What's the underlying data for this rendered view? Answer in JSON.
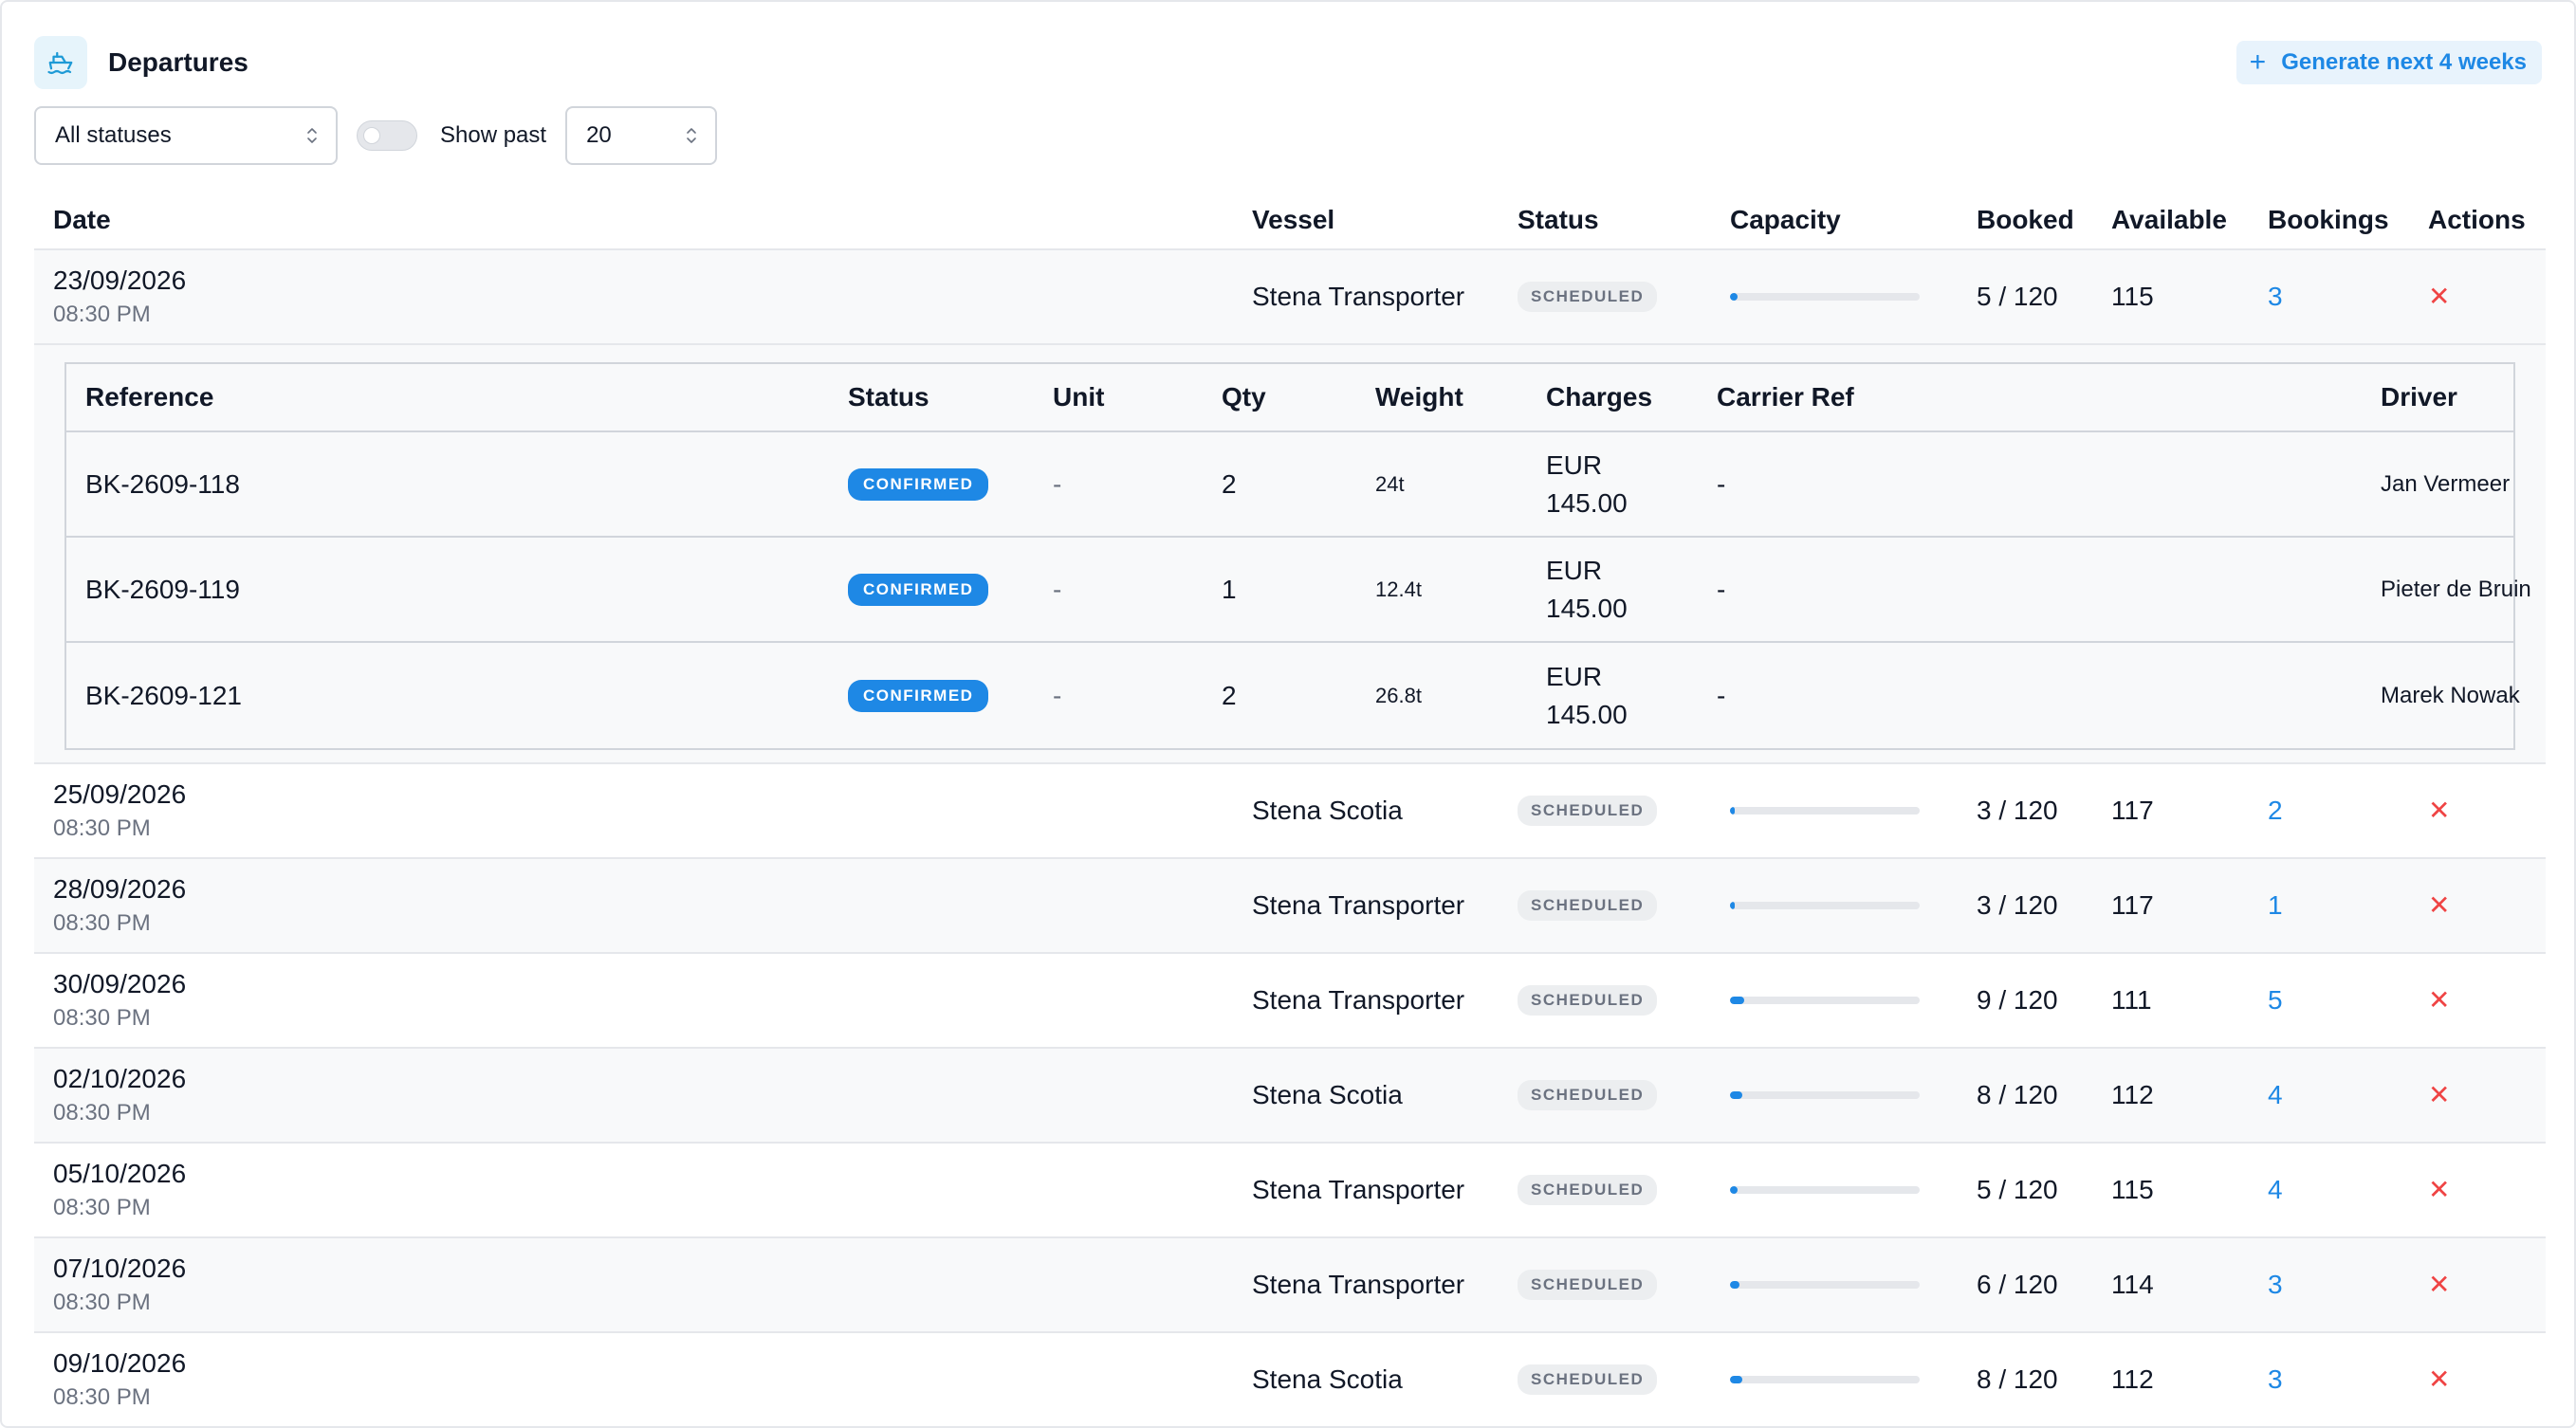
{
  "header": {
    "title": "Departures",
    "generate_label": "Generate next 4 weeks",
    "generate_icon": "plus-icon",
    "logo_icon": "ship-icon"
  },
  "filters": {
    "status_value": "All statuses",
    "show_past_label": "Show past",
    "show_past_on": false,
    "page_size_value": "20"
  },
  "columns": {
    "date": "Date",
    "vessel": "Vessel",
    "status": "Status",
    "capacity": "Capacity",
    "booked": "Booked",
    "available": "Available",
    "bookings": "Bookings",
    "actions": "Actions"
  },
  "departures": [
    {
      "date": "23/09/2026",
      "time": "08:30 PM",
      "vessel": "Stena Transporter",
      "status": "SCHEDULED",
      "capacity": 0.0417,
      "booked": "5 / 120",
      "available": "115",
      "bookings": "3"
    },
    {
      "date": "25/09/2026",
      "time": "08:30 PM",
      "vessel": "Stena Scotia",
      "status": "SCHEDULED",
      "capacity": 0.025,
      "booked": "3 / 120",
      "available": "117",
      "bookings": "2"
    },
    {
      "date": "28/09/2026",
      "time": "08:30 PM",
      "vessel": "Stena Transporter",
      "status": "SCHEDULED",
      "capacity": 0.025,
      "booked": "3 / 120",
      "available": "117",
      "bookings": "1"
    },
    {
      "date": "30/09/2026",
      "time": "08:30 PM",
      "vessel": "Stena Transporter",
      "status": "SCHEDULED",
      "capacity": 0.075,
      "booked": "9 / 120",
      "available": "111",
      "bookings": "5"
    },
    {
      "date": "02/10/2026",
      "time": "08:30 PM",
      "vessel": "Stena Scotia",
      "status": "SCHEDULED",
      "capacity": 0.0667,
      "booked": "8 / 120",
      "available": "112",
      "bookings": "4"
    },
    {
      "date": "05/10/2026",
      "time": "08:30 PM",
      "vessel": "Stena Transporter",
      "status": "SCHEDULED",
      "capacity": 0.0417,
      "booked": "5 / 120",
      "available": "115",
      "bookings": "4"
    },
    {
      "date": "07/10/2026",
      "time": "08:30 PM",
      "vessel": "Stena Transporter",
      "status": "SCHEDULED",
      "capacity": 0.05,
      "booked": "6 / 120",
      "available": "114",
      "bookings": "3"
    },
    {
      "date": "09/10/2026",
      "time": "08:30 PM",
      "vessel": "Stena Scotia",
      "status": "SCHEDULED",
      "capacity": 0.0667,
      "booked": "8 / 120",
      "available": "112",
      "bookings": "3"
    }
  ],
  "booking_columns": {
    "reference": "Reference",
    "status": "Status",
    "unit": "Unit",
    "qty": "Qty",
    "weight": "Weight",
    "charges": "Charges",
    "carrier_ref": "Carrier Ref",
    "driver": "Driver"
  },
  "bookings": [
    {
      "reference": "BK-2609-118",
      "status": "CONFIRMED",
      "unit": "-",
      "qty": "2",
      "weight": "24t",
      "currency": "EUR",
      "amount": "145.00",
      "carrier_ref": "-",
      "driver": "Jan Vermeer"
    },
    {
      "reference": "BK-2609-119",
      "status": "CONFIRMED",
      "unit": "-",
      "qty": "1",
      "weight": "12.4t",
      "currency": "EUR",
      "amount": "145.00",
      "carrier_ref": "-",
      "driver": "Pieter de Bruin"
    },
    {
      "reference": "BK-2609-121",
      "status": "CONFIRMED",
      "unit": "-",
      "qty": "2",
      "weight": "26.8t",
      "currency": "EUR",
      "amount": "145.00",
      "carrier_ref": "-",
      "driver": "Marek Nowak"
    }
  ],
  "colors": {
    "accent": "#1e88e5",
    "danger": "#ef4444",
    "muted": "#6b7280",
    "row_alt": "#f8f9fa"
  }
}
